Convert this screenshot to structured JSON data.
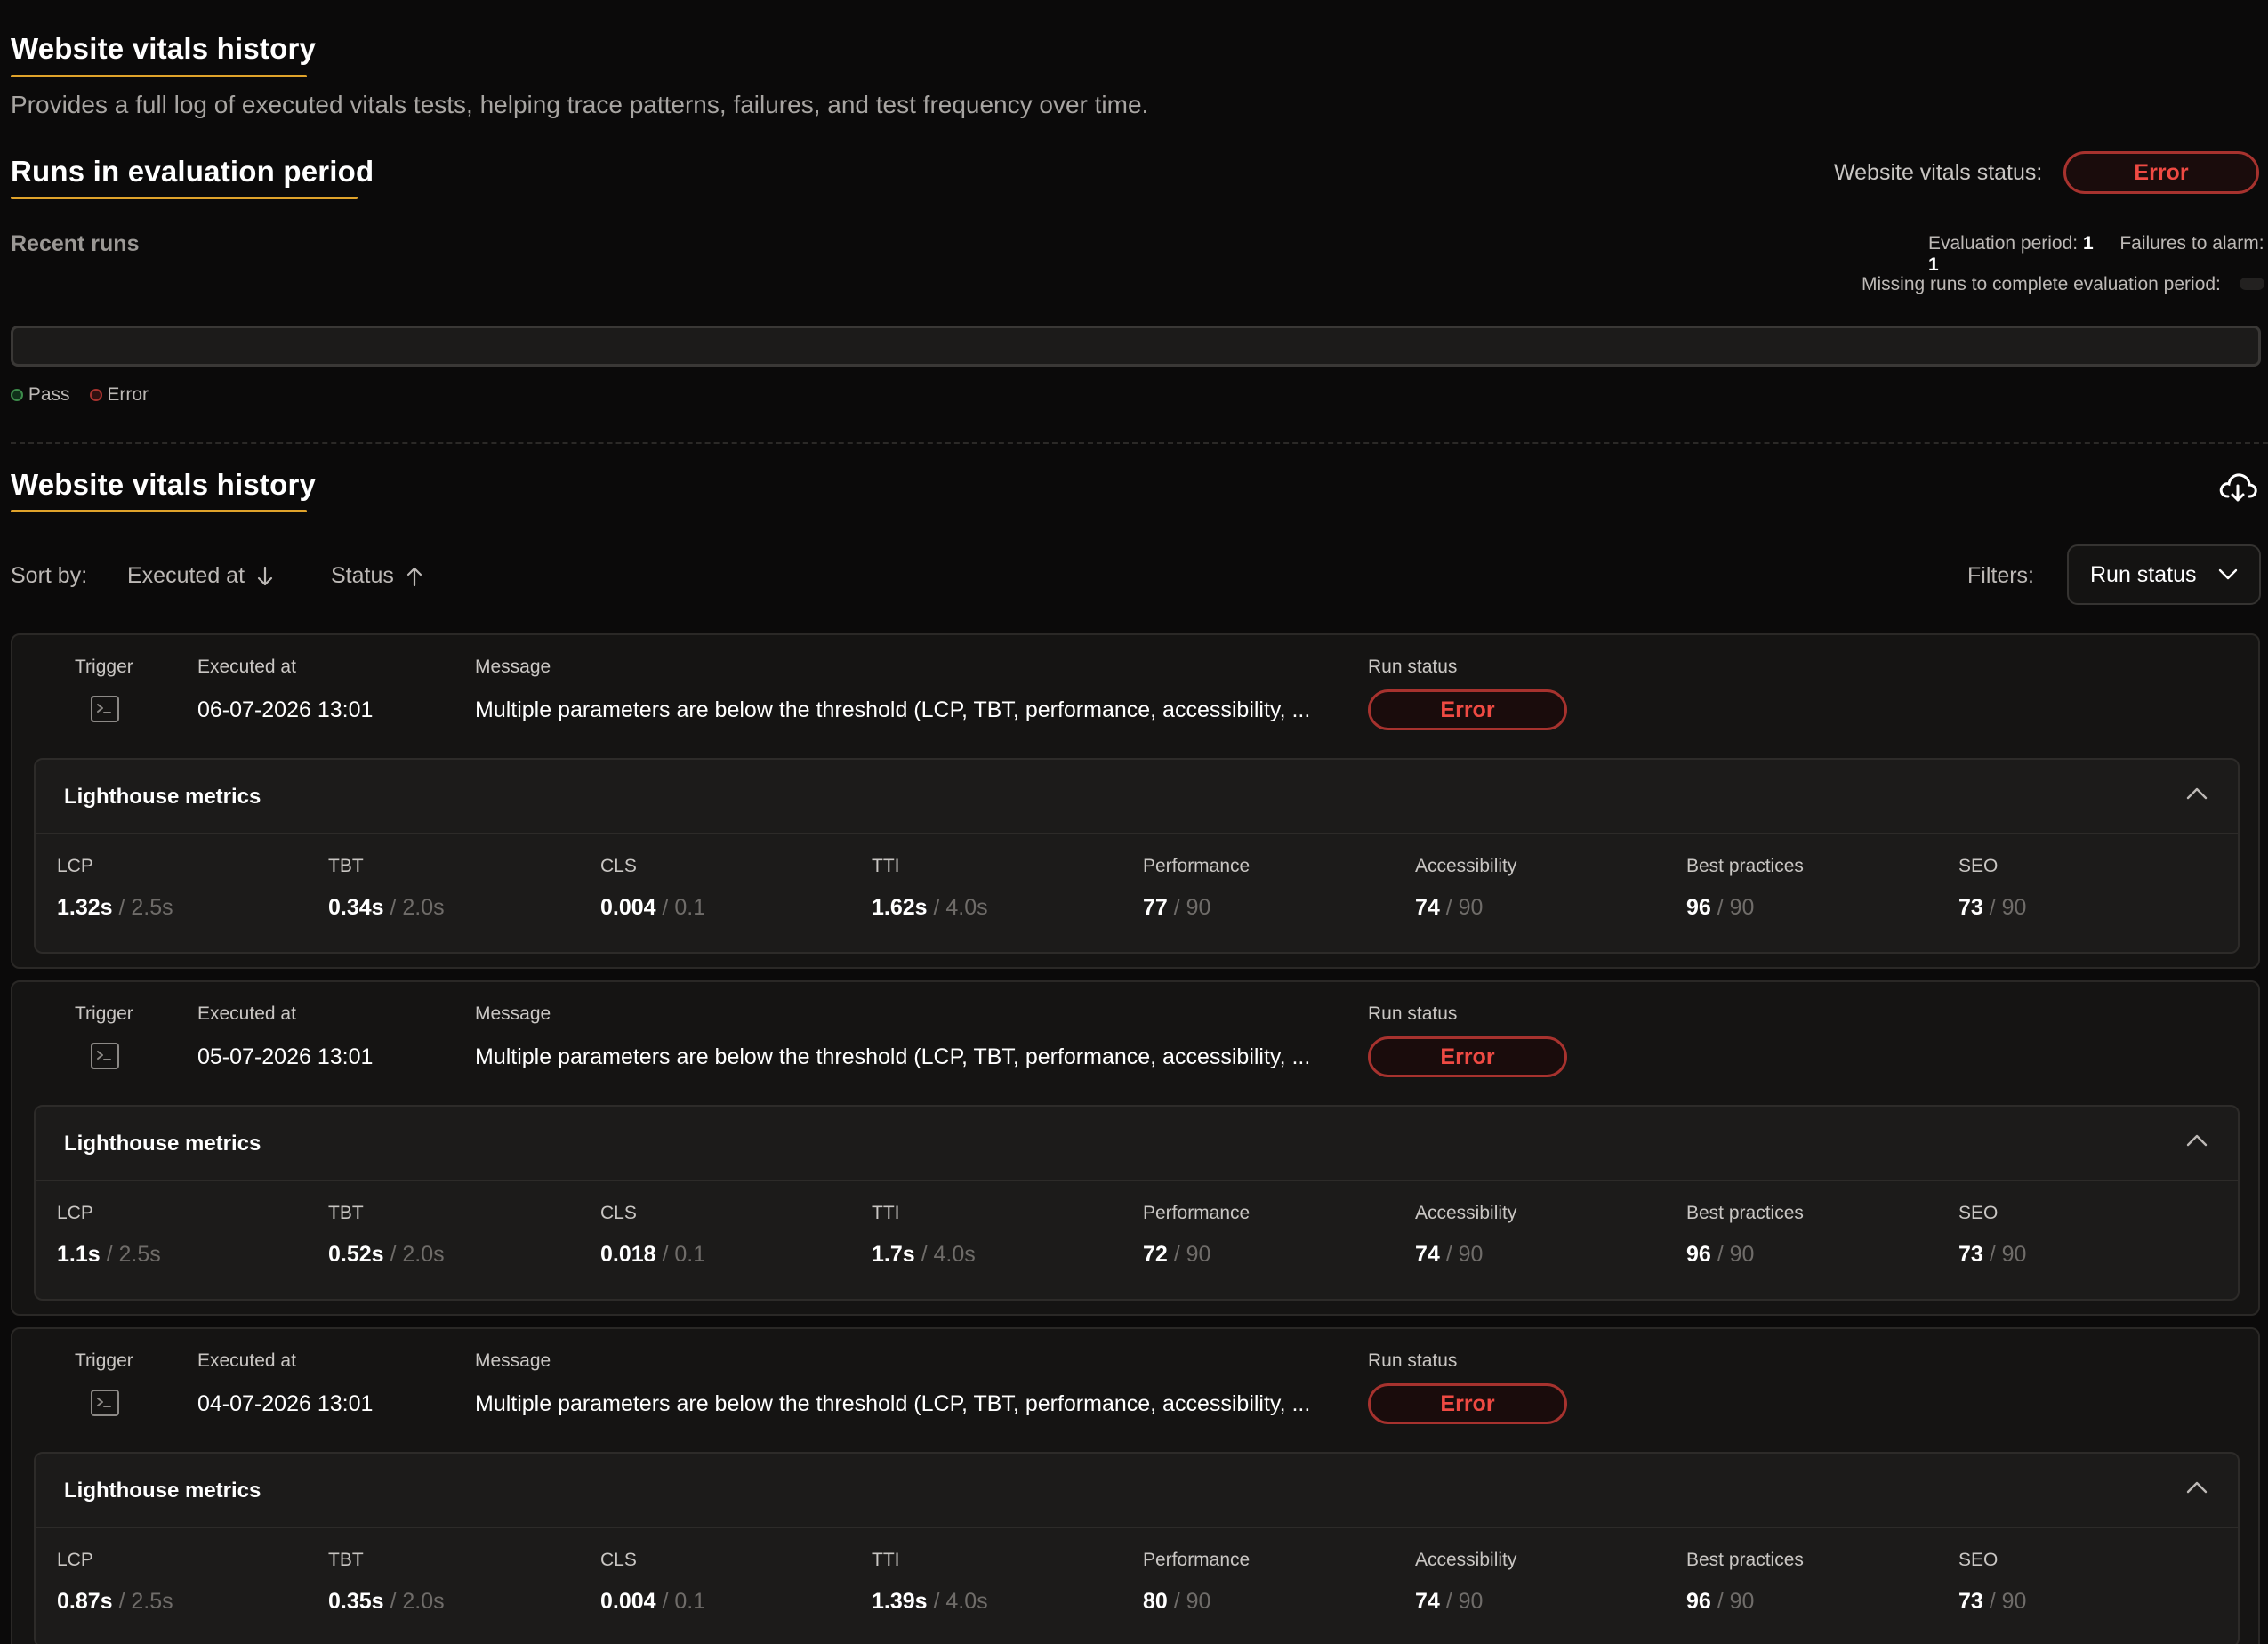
{
  "header": {
    "title": "Website vitals history",
    "description": "Provides a full log of executed vitals tests, helping trace patterns, failures, and test frequency over time."
  },
  "evaluation": {
    "title": "Runs in evaluation period",
    "status_label": "Website vitals status:",
    "status_value": "Error",
    "recent_runs_label": "Recent runs",
    "period_label": "Evaluation period:",
    "period_value": "1",
    "failures_label": "Failures to alarm:",
    "failures_value": "1",
    "missing_label": "Missing runs to complete evaluation period:",
    "legend": [
      {
        "label": "Pass",
        "color": "#3c8a4a"
      },
      {
        "label": "Error",
        "color": "#a7322e"
      }
    ]
  },
  "history": {
    "title": "Website vitals history",
    "sort_label": "Sort by:",
    "sort_options": [
      {
        "label": "Executed at",
        "direction": "down"
      },
      {
        "label": "Status",
        "direction": "up"
      }
    ],
    "filters_label": "Filters:",
    "filter_button": "Run status",
    "download_icon": "cloud-download-icon"
  },
  "columns": {
    "trigger": "Trigger",
    "executed_at": "Executed at",
    "message": "Message",
    "run_status": "Run status",
    "metrics_title": "Lighthouse metrics"
  },
  "runs": [
    {
      "executed_at": "06-07-2026 13:01",
      "message": "Multiple parameters are below the threshold (LCP, TBT, performance, accessibility, ...",
      "status": "Error",
      "metrics": [
        {
          "label": "LCP",
          "value": "1.32s",
          "threshold": "/ 2.5s"
        },
        {
          "label": "TBT",
          "value": "0.34s",
          "threshold": "/ 2.0s"
        },
        {
          "label": "CLS",
          "value": "0.004",
          "threshold": "/ 0.1"
        },
        {
          "label": "TTI",
          "value": "1.62s",
          "threshold": "/ 4.0s"
        },
        {
          "label": "Performance",
          "value": "77",
          "threshold": "/ 90"
        },
        {
          "label": "Accessibility",
          "value": "74",
          "threshold": "/ 90"
        },
        {
          "label": "Best practices",
          "value": "96",
          "threshold": "/ 90"
        },
        {
          "label": "SEO",
          "value": "73",
          "threshold": "/ 90"
        }
      ]
    },
    {
      "executed_at": "05-07-2026 13:01",
      "message": "Multiple parameters are below the threshold (LCP, TBT, performance, accessibility, ...",
      "status": "Error",
      "metrics": [
        {
          "label": "LCP",
          "value": "1.1s",
          "threshold": "/ 2.5s"
        },
        {
          "label": "TBT",
          "value": "0.52s",
          "threshold": "/ 2.0s"
        },
        {
          "label": "CLS",
          "value": "0.018",
          "threshold": "/ 0.1"
        },
        {
          "label": "TTI",
          "value": "1.7s",
          "threshold": "/ 4.0s"
        },
        {
          "label": "Performance",
          "value": "72",
          "threshold": "/ 90"
        },
        {
          "label": "Accessibility",
          "value": "74",
          "threshold": "/ 90"
        },
        {
          "label": "Best practices",
          "value": "96",
          "threshold": "/ 90"
        },
        {
          "label": "SEO",
          "value": "73",
          "threshold": "/ 90"
        }
      ]
    },
    {
      "executed_at": "04-07-2026 13:01",
      "message": "Multiple parameters are below the threshold (LCP, TBT, performance, accessibility, ...",
      "status": "Error",
      "metrics": [
        {
          "label": "LCP",
          "value": "0.87s",
          "threshold": "/ 2.5s"
        },
        {
          "label": "TBT",
          "value": "0.35s",
          "threshold": "/ 2.0s"
        },
        {
          "label": "CLS",
          "value": "0.004",
          "threshold": "/ 0.1"
        },
        {
          "label": "TTI",
          "value": "1.39s",
          "threshold": "/ 4.0s"
        },
        {
          "label": "Performance",
          "value": "80",
          "threshold": "/ 90"
        },
        {
          "label": "Accessibility",
          "value": "74",
          "threshold": "/ 90"
        },
        {
          "label": "Best practices",
          "value": "96",
          "threshold": "/ 90"
        },
        {
          "label": "SEO",
          "value": "73",
          "threshold": "/ 90"
        }
      ]
    }
  ],
  "colors": {
    "accent": "#e0a32b",
    "error": "#ef4a43",
    "pass": "#3c8a4a"
  }
}
